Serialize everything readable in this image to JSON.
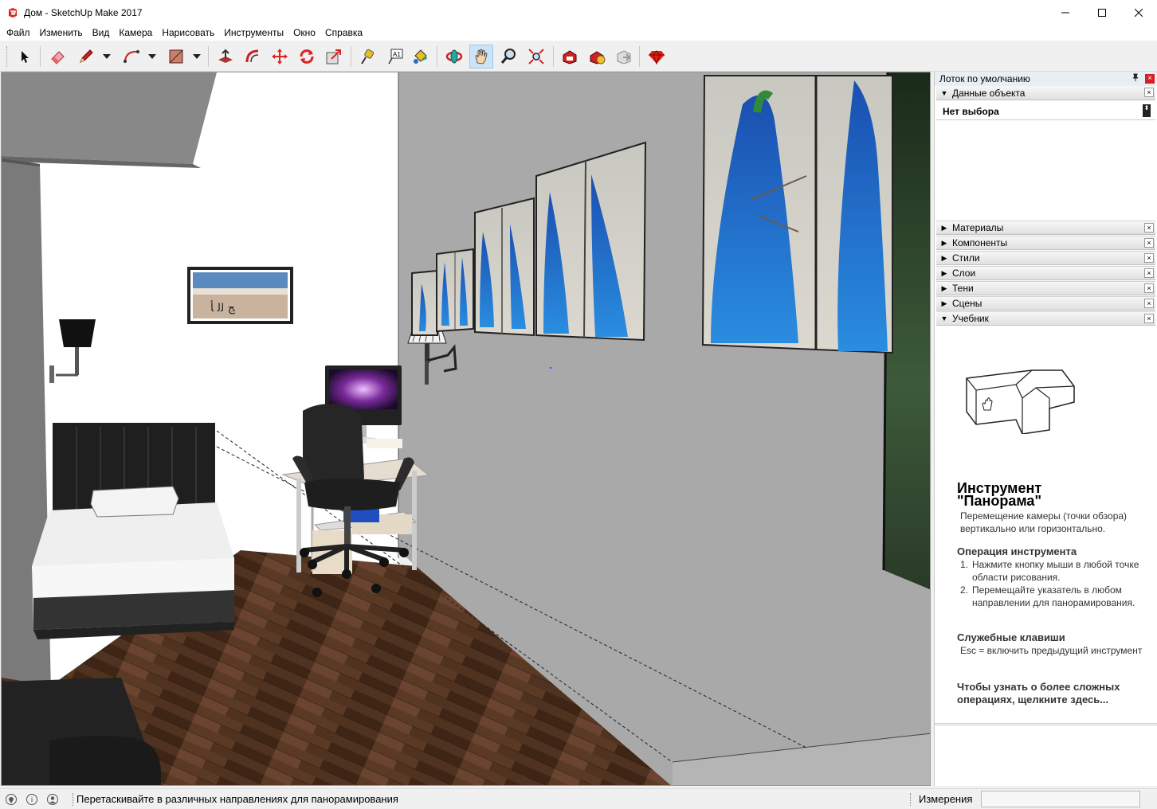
{
  "window": {
    "title": "Дом - SketchUp Make 2017",
    "minimize_glyph": "─",
    "maximize_glyph": "☐",
    "close_glyph": "✕"
  },
  "menu": {
    "items": [
      "Файл",
      "Изменить",
      "Вид",
      "Камера",
      "Нарисовать",
      "Инструменты",
      "Окно",
      "Справка"
    ]
  },
  "toolbar": {
    "tools": [
      {
        "name": "select-tool-icon"
      },
      {
        "name": "eraser-tool-icon"
      },
      {
        "name": "pencil-line-tool-icon"
      },
      {
        "name": "arc-tool-icon"
      },
      {
        "name": "rectangle-tool-icon"
      },
      {
        "name": "push-pull-tool-icon"
      },
      {
        "name": "offset-tool-icon"
      },
      {
        "name": "move-tool-icon"
      },
      {
        "name": "rotate-tool-icon"
      },
      {
        "name": "scale-tool-icon"
      },
      {
        "name": "tape-measure-tool-icon"
      },
      {
        "name": "text-tool-icon"
      },
      {
        "name": "paint-bucket-tool-icon"
      },
      {
        "name": "orbit-tool-icon"
      },
      {
        "name": "pan-tool-icon"
      },
      {
        "name": "zoom-tool-icon"
      },
      {
        "name": "zoom-extents-tool-icon"
      },
      {
        "name": "warehouse-icon"
      },
      {
        "name": "share-model-icon"
      },
      {
        "name": "extension-warehouse-icon"
      },
      {
        "name": "ruby-extension-icon"
      }
    ],
    "active_tool": "pan-tool-icon",
    "text_tool_label": "A1"
  },
  "tray": {
    "title": "Лоток по умолчанию",
    "pin_glyph": "📌",
    "close_glyph": "×",
    "entity_info": {
      "label": "Данные объекта",
      "selection": "Нет выбора"
    },
    "panels": [
      "Материалы",
      "Компоненты",
      "Стили",
      "Слои",
      "Тени",
      "Сцены",
      "Учебник"
    ],
    "instructor": {
      "title_line1": "Инструмент",
      "title_line2": "\"Панорама\"",
      "description": "Перемещение камеры (точки обзора) вертикально или горизонтально.",
      "operation_title": "Операция инструмента",
      "steps": [
        {
          "num": "1.",
          "text": "Нажмите кнопку мыши в любой точке области рисования."
        },
        {
          "num": "2.",
          "text": "Перемещайте указатель в любом направлении для панорамирования."
        }
      ],
      "keys_title": "Служебные клавиши",
      "keys_text": "Esc = включить предыдущий инструмент",
      "more": "Чтобы узнать о более сложных операциях, щелкните здесь..."
    }
  },
  "statusbar": {
    "geo_icon": "geo-location-icon",
    "credits_icon": "info-icon",
    "user_icon": "user-icon",
    "text": "Перетаскивайте в различных направлениях для панорамирования",
    "measurements_label": "Измерения",
    "measurements_value": ""
  },
  "colors": {
    "wall_white": "#ffffff",
    "wall_gray": "#a9a9a9",
    "floor": "#4a2e1c",
    "peacock_blue": "#1f6fc4",
    "tray_header": "#e9eef5",
    "active_tool_bg": "#cce4f7"
  }
}
